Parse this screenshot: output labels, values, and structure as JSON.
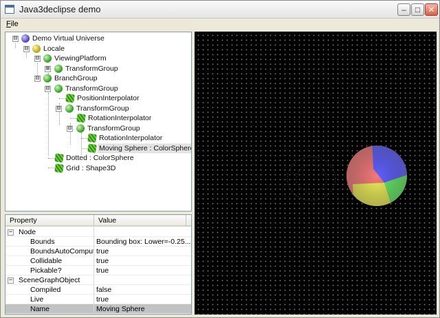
{
  "window": {
    "title": "Java3declipse demo",
    "minimize": "–",
    "maximize": "□",
    "close": "✕"
  },
  "menu": {
    "file_label_u": "F",
    "file_label_rest": "ile"
  },
  "tree": {
    "nodes": [
      {
        "label": "Demo Virtual Universe",
        "icon": "universe-icon",
        "expander": "⊟"
      },
      {
        "label": "Locale",
        "icon": "locale-icon",
        "expander": "⊟"
      },
      {
        "label": "ViewingPlatform",
        "icon": "group-icon",
        "expander": "⊟"
      },
      {
        "label": "TransformGroup",
        "icon": "group-icon",
        "expander": "⊞"
      },
      {
        "label": "BranchGroup",
        "icon": "group-icon",
        "expander": "⊟"
      },
      {
        "label": "TransformGroup",
        "icon": "group-icon",
        "expander": "⊟"
      },
      {
        "label": "PositionInterpolator",
        "icon": "behavior-icon",
        "expander": ""
      },
      {
        "label": "TransformGroup",
        "icon": "group-icon",
        "expander": "⊟"
      },
      {
        "label": "RotationInterpolator",
        "icon": "behavior-icon",
        "expander": ""
      },
      {
        "label": "TransformGroup",
        "icon": "group-icon",
        "expander": "⊟"
      },
      {
        "label": "RotationInterpolator",
        "icon": "behavior-icon",
        "expander": ""
      },
      {
        "label": "Moving Sphere : ColorSphere",
        "icon": "shape-icon",
        "expander": "",
        "selected": true
      },
      {
        "label": "Dotted : ColorSphere",
        "icon": "shape-icon",
        "expander": ""
      },
      {
        "label": "Grid : Shape3D",
        "icon": "shape-icon",
        "expander": ""
      }
    ]
  },
  "properties": {
    "header_property": "Property",
    "header_value": "Value",
    "rows": [
      {
        "name": "Node",
        "value": "",
        "category": true
      },
      {
        "name": "Bounds",
        "value": "Bounding box: Lower=-0.25..."
      },
      {
        "name": "BoundsAutoCompute",
        "value": "true"
      },
      {
        "name": "Collidable",
        "value": "true"
      },
      {
        "name": "Pickable?",
        "value": "true"
      },
      {
        "name": "SceneGraphObject",
        "value": "",
        "category": true
      },
      {
        "name": "Compiled",
        "value": "false"
      },
      {
        "name": "Live",
        "value": "true"
      },
      {
        "name": "Name",
        "value": "Moving Sphere",
        "selected": true
      }
    ]
  },
  "scene": {
    "background": "#000000",
    "sphere_colors": [
      "#6060ff",
      "#66ee66",
      "#f2f25a",
      "#f47a7a"
    ]
  }
}
